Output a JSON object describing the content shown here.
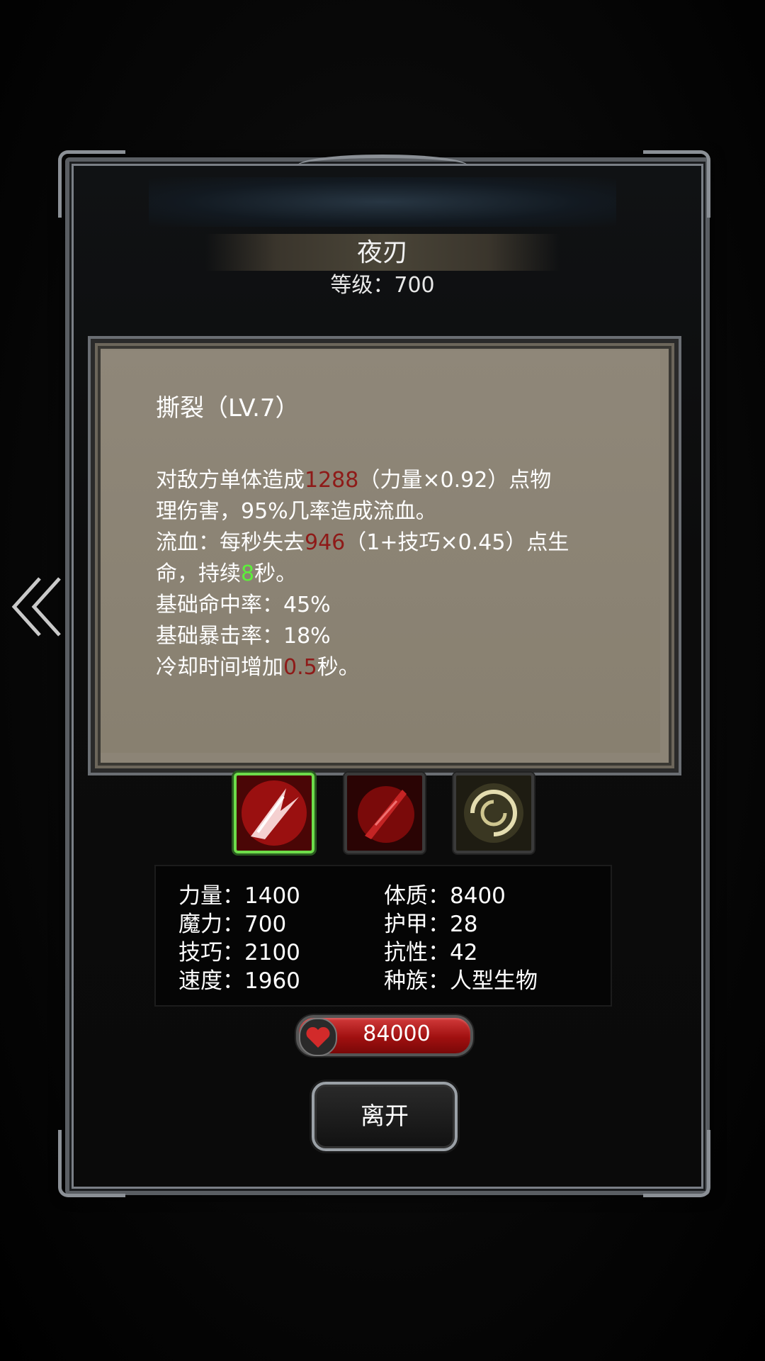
{
  "monster": {
    "name": "夜刃",
    "level_text": "等级：700"
  },
  "skill": {
    "title": "撕裂（LV.7）",
    "desc": [
      {
        "parts": [
          {
            "t": "对敌方单体造成"
          },
          {
            "t": "1288",
            "c": "red"
          },
          {
            "t": "（力量×0.92）点物"
          }
        ]
      },
      {
        "parts": [
          {
            "t": "理伤害，95%几率造成流血。"
          }
        ]
      },
      {
        "parts": [
          {
            "t": "流血：每秒失去"
          },
          {
            "t": "946",
            "c": "red"
          },
          {
            "t": "（1+技巧×0.45）点生"
          }
        ]
      },
      {
        "parts": [
          {
            "t": "命，持续"
          },
          {
            "t": "8",
            "c": "green"
          },
          {
            "t": "秒。"
          }
        ]
      },
      {
        "parts": [
          {
            "t": "基础命中率：45%"
          }
        ]
      },
      {
        "parts": [
          {
            "t": "基础暴击率：18%"
          }
        ]
      },
      {
        "parts": [
          {
            "t": "冷却时间增加"
          },
          {
            "t": "0.5",
            "c": "red"
          },
          {
            "t": "秒。"
          }
        ]
      }
    ]
  },
  "skill_icons": [
    {
      "name": "skill-icon-slash",
      "selected": true
    },
    {
      "name": "skill-icon-blade",
      "selected": false
    },
    {
      "name": "skill-icon-vortex",
      "selected": false
    }
  ],
  "stats": {
    "strength": "力量：1400",
    "magic": "魔力：700",
    "skill": "技巧：2100",
    "speed": "速度：1960",
    "constitution": "体质：8400",
    "armor": "护甲：28",
    "resistance": "抗性：42",
    "race": "种族：人型生物"
  },
  "hp": {
    "value": "84000",
    "icon": "heart-icon"
  },
  "buttons": {
    "leave": "离开",
    "prev_icon": "double-chevron-left-icon"
  },
  "colors": {
    "damage_red": "#8e1a18",
    "duration_green": "#5cf03a",
    "panel_bg": "#8c8476",
    "selected_border": "#6ddc4a"
  }
}
